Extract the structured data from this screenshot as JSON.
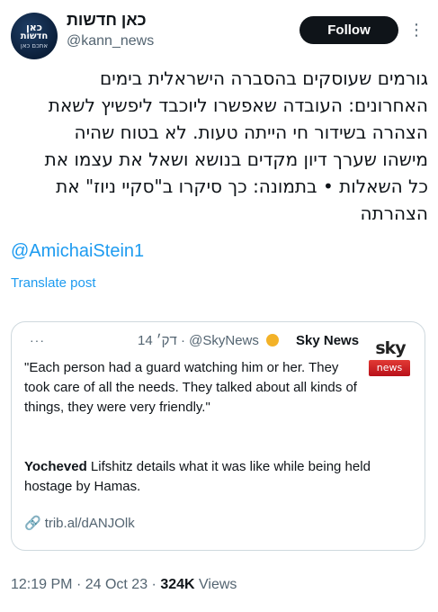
{
  "author": {
    "avatar_lines": [
      "כאן",
      "חדשות",
      "אתכם כאן"
    ],
    "display_name": "כאן חדשות",
    "handle": "@kann_news"
  },
  "actions": {
    "follow_label": "Follow",
    "more_glyph": "⋮"
  },
  "tweet": {
    "lines": [
      "גורמים שעוסקים בהסברה הישראלית בימים",
      "האחרונים: העובדה שאפשרו ליוכבד ליפשיץ לשאת",
      "הצהרה בשידור חי הייתה טעות. לא בטוח שהיה",
      "מישהו שערך דיון מקדים בנושא ושאל את עצמו את",
      "כל השאלות • בתמונה: כך סיקרו ב\"סקיי ניוז\" את",
      "הצהרתה"
    ],
    "mention": "@AmichaiStein1",
    "translate_label": "Translate post"
  },
  "quote": {
    "dots": "···",
    "time": "14 דק׳",
    "separator": "·",
    "handle": "@SkyNews",
    "name": "Sky News",
    "logo_word": "sky",
    "logo_badge": "news",
    "quote_text": "\"Each person had a guard watching him or her. They took care of all the needs. They talked about all kinds of things, they were very friendly.\"",
    "body_bold": "Yocheved",
    "body_rest": " Lifshitz details what it was like while being held hostage by Hamas.",
    "link_icon": "🔗",
    "link_text": "trib.al/dANJOlk",
    "accent_colors": {
      "sun": "#f3b228",
      "sky_red": "#d42028"
    }
  },
  "footer": {
    "time": "12:19 PM",
    "dot": "·",
    "date": "24 Oct 23",
    "views_count": "324K",
    "views_label": "Views"
  },
  "colors": {
    "link": "#1d9bf0",
    "muted": "#536471",
    "text": "#0f1419",
    "border": "#cfd9de"
  }
}
